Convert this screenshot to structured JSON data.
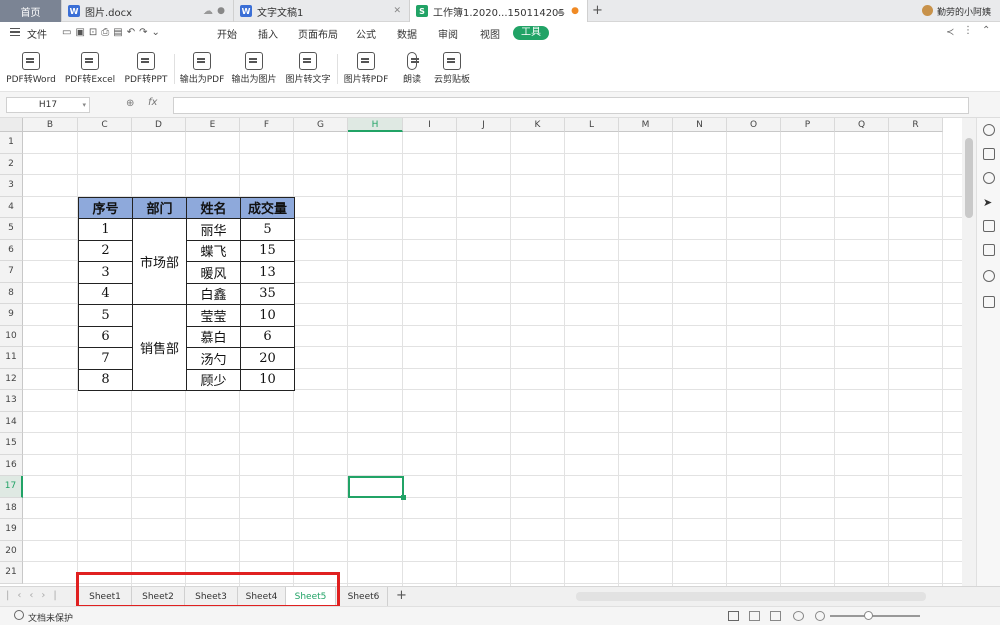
{
  "tabs": [
    {
      "label": "首页",
      "active": false
    },
    {
      "label": "图片.docx",
      "icon": "word-doc-icon",
      "active": false
    },
    {
      "label": "文字文稿1",
      "icon": "word-doc-icon",
      "active": false
    },
    {
      "label": "工作簿1.2020...150114205",
      "icon": "spreadsheet-icon",
      "active": true
    }
  ],
  "user_name": "勤劳的小阿姨",
  "menu": {
    "file": "文件",
    "items": [
      "开始",
      "插入",
      "页面布局",
      "公式",
      "数据",
      "审阅",
      "视图"
    ],
    "active": "工具"
  },
  "ribbon": [
    "PDF转Word",
    "PDF转Excel",
    "PDF转PPT",
    "输出为PDF",
    "输出为图片",
    "图片转文字",
    "图片转PDF",
    "朗读",
    "云剪贴板"
  ],
  "formula": {
    "cell_ref": "H17",
    "fx": "fx",
    "value": ""
  },
  "columns": [
    "B",
    "C",
    "D",
    "E",
    "F",
    "G",
    "H",
    "I",
    "J",
    "K",
    "L",
    "M",
    "N",
    "O",
    "P",
    "Q",
    "R"
  ],
  "rows": [
    "1",
    "2",
    "3",
    "4",
    "5",
    "6",
    "7",
    "8",
    "9",
    "10",
    "11",
    "12",
    "13",
    "14",
    "15",
    "16",
    "17",
    "18",
    "19",
    "20",
    "21"
  ],
  "selected": {
    "column": "H",
    "row": "17"
  },
  "table": {
    "headers": [
      "序号",
      "部门",
      "姓名",
      "成交量"
    ],
    "departments": [
      "市场部",
      "销售部"
    ],
    "rows": [
      [
        "1",
        "丽华",
        "5"
      ],
      [
        "2",
        "蝶飞",
        "15"
      ],
      [
        "3",
        "暖风",
        "13"
      ],
      [
        "4",
        "白鑫",
        "35"
      ],
      [
        "5",
        "莹莹",
        "10"
      ],
      [
        "6",
        "慕白",
        "6"
      ],
      [
        "7",
        "汤勺",
        "20"
      ],
      [
        "8",
        "顾少",
        "10"
      ]
    ]
  },
  "sheets": [
    "Sheet1",
    "Sheet2",
    "Sheet3",
    "Sheet4",
    "Sheet5",
    "Sheet6"
  ],
  "active_sheet": "Sheet5",
  "add_sheet": "+",
  "status": {
    "protection": "文档未保护"
  },
  "colors": {
    "accent": "#21a366",
    "table_header": "#8ea9db",
    "highlight": "#e02020"
  }
}
